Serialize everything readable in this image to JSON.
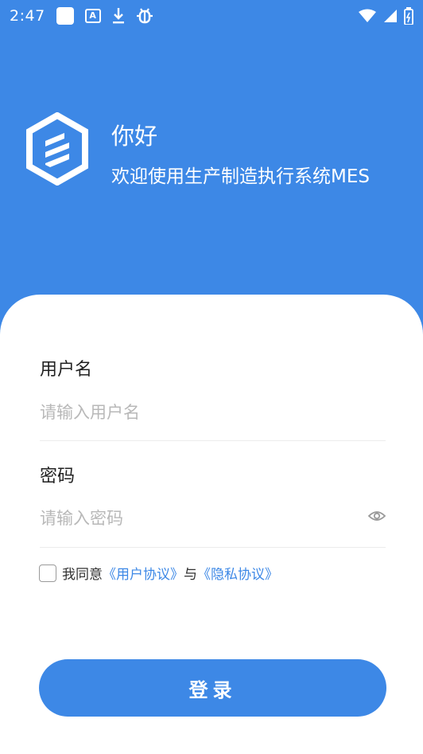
{
  "status_bar": {
    "time": "2:47",
    "icons": [
      "square-notification-icon",
      "a-box-icon",
      "download-icon",
      "bug-icon",
      "wifi-icon",
      "signal-icon",
      "battery-icon"
    ]
  },
  "header": {
    "title": "你好",
    "subtitle": "欢迎使用生产制造执行系统MES"
  },
  "form": {
    "username_label": "用户名",
    "username_placeholder": "请输入用户名",
    "password_label": "密码",
    "password_placeholder": "请输入密码",
    "agree_prefix": "我同意",
    "user_agreement": "《用户协议》",
    "agree_and": "与",
    "privacy_policy": "《隐私协议》",
    "login_label": "登录"
  },
  "colors": {
    "primary": "#3D88E6",
    "background": "#FFFFFF"
  }
}
